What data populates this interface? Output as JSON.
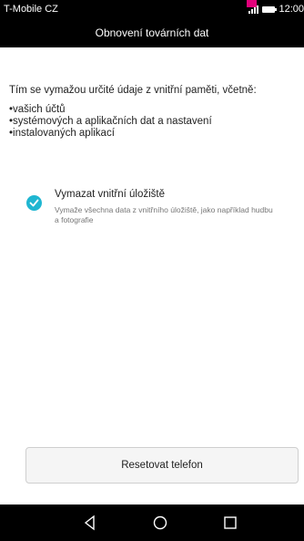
{
  "status_bar": {
    "carrier": "T-Mobile CZ",
    "time": "12:00",
    "signal_icon": "signal-icon",
    "battery_icon": "battery-icon"
  },
  "header": {
    "title": "Obnovení továrních dat"
  },
  "main": {
    "intro": "Tím se vymažou určité údaje z vnitřní paměti, včetně:",
    "items": [
      "vašich účtů",
      "systémových a aplikačních dat a nastavení",
      "instalovaných aplikací"
    ],
    "option": {
      "title": "Vymazat vnitřní úložiště",
      "description": "Vymaže všechna data z vnitřního úložiště, jako například hudbu a fotografie",
      "checked": true
    }
  },
  "actions": {
    "reset_label": "Resetovat telefon"
  },
  "nav": {
    "back_icon": "back-icon",
    "home_icon": "home-icon",
    "recent_icon": "recent-apps-icon"
  },
  "colors": {
    "accent": "#1fb6d1",
    "marker": "#e2007a",
    "bar_bg": "#000000"
  }
}
